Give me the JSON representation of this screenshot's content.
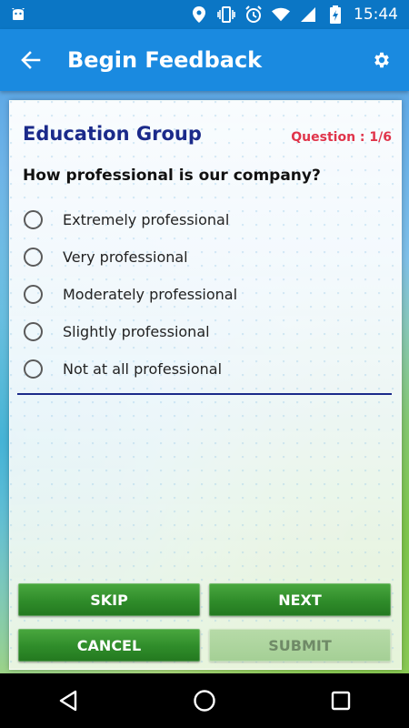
{
  "status_bar": {
    "time": "15:44",
    "icons": [
      "android-icon",
      "location-icon",
      "vibrate-icon",
      "alarm-icon",
      "wifi-icon",
      "signal-icon",
      "battery-charging-icon"
    ]
  },
  "app_bar": {
    "title": "Begin Feedback",
    "back_icon": "arrow-back-icon",
    "settings_icon": "gear-icon"
  },
  "survey": {
    "group_title": "Education Group",
    "question_counter": "Question : 1/6",
    "question": "How professional is our company?",
    "options": [
      {
        "label": "Extremely professional",
        "selected": false
      },
      {
        "label": "Very professional",
        "selected": false
      },
      {
        "label": "Moderately professional",
        "selected": false
      },
      {
        "label": "Slightly professional",
        "selected": false
      },
      {
        "label": "Not at all professional",
        "selected": false
      }
    ]
  },
  "buttons": {
    "skip": "SKIP",
    "next": "NEXT",
    "cancel": "CANCEL",
    "submit": "SUBMIT",
    "submit_enabled": false
  },
  "colors": {
    "app_bar": "#1a8ae0",
    "status_bar": "#0b76c5",
    "group_title": "#1b2a8a",
    "question_counter": "#e0344a",
    "button_green": "#2f8c2a",
    "button_disabled": "#a4cf95"
  },
  "nav_bar": {
    "icons": [
      "back-triangle-icon",
      "home-circle-icon",
      "recents-square-icon"
    ]
  }
}
